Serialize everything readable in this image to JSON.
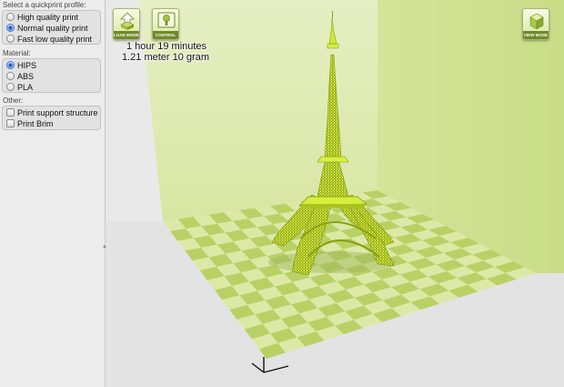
{
  "panel": {
    "profile_label": "Select a quickprint profile:",
    "profiles": [
      {
        "label": "High quality print",
        "selected": false
      },
      {
        "label": "Normal quality print",
        "selected": true
      },
      {
        "label": "Fast low quality print",
        "selected": false
      }
    ],
    "material_label": "Material:",
    "materials": [
      {
        "label": "HIPS",
        "selected": true
      },
      {
        "label": "ABS",
        "selected": false
      },
      {
        "label": "PLA",
        "selected": false
      }
    ],
    "other_label": "Other:",
    "others": [
      {
        "label": "Print support structure",
        "checked": false
      },
      {
        "label": "Print Brim",
        "checked": false
      }
    ]
  },
  "toolbar": {
    "load_model_label": "LOAD MODEL",
    "control_label": "CONTROL",
    "view_mode_label": "VIEW MODE"
  },
  "estimate": {
    "time": "1 hour 19 minutes",
    "material": "1.21 meter 10 gram"
  },
  "colors": {
    "model": "#d4ee3a",
    "model_shade": "#8aa014",
    "tile_light": "#dce9a6",
    "tile_dark": "#b9d164",
    "wall": "#dde8b4"
  },
  "icons": {
    "load_model": "load-model-icon",
    "control": "control-icon",
    "view_mode": "view-mode-icon",
    "axis": "axis-indicator-icon"
  }
}
